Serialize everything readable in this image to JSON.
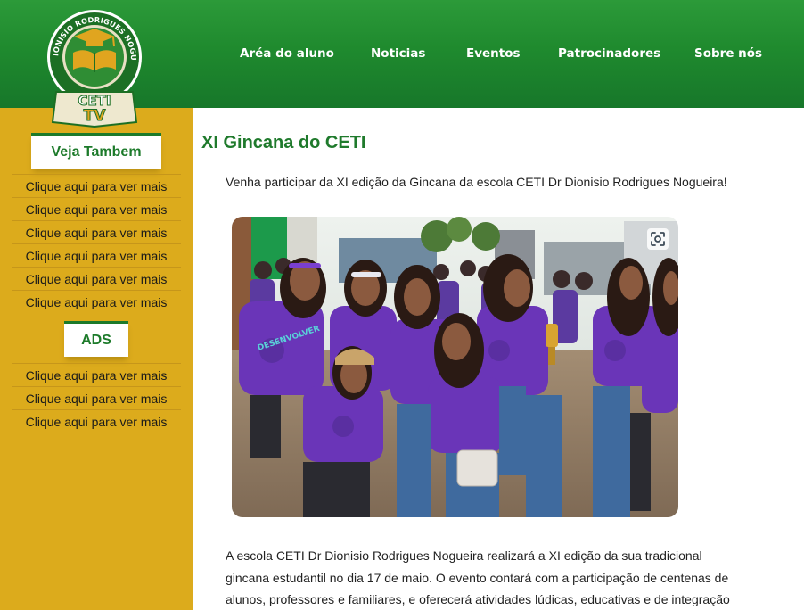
{
  "logo": {
    "ring_text": "DR. DIONISIO RODRIGUES NOGUEIRA",
    "line1": "CETI",
    "line2": "TV"
  },
  "nav": {
    "items": [
      {
        "label": "Aréa do aluno"
      },
      {
        "label": "Noticias"
      },
      {
        "label": "Eventos"
      },
      {
        "label": "Patrocinadores"
      },
      {
        "label": "Sobre nós"
      }
    ]
  },
  "sidebar": {
    "heading1": "Veja Tambem",
    "links1": [
      "Clique aqui para ver mais",
      "Clique aqui para ver mais",
      "Clique aqui para ver mais",
      "Clique aqui para ver mais",
      "Clique aqui para ver mais",
      "Clique aqui para ver mais"
    ],
    "heading2": "ADS",
    "links2": [
      "Clique aqui para ver mais",
      "Clique aqui para ver mais",
      "Clique aqui para ver mais"
    ]
  },
  "article": {
    "title": "XI Gincana do CETI",
    "intro": "Venha participar da XI edição da Gincana da escola CETI Dr Dionisio Rodrigues Nogueira!",
    "shirt_text": "DESENVOLVER",
    "body_lines": [
      "A escola CETI Dr Dionisio Rodrigues Nogueira realizará a XI edição da sua tradicional",
      "gincana estudantil no dia 17 de maio. O evento contará com a participação de centenas de",
      "alunos, professores e familiares, e oferecerá atividades lúdicas, educativas e de integração"
    ]
  },
  "colors": {
    "header_green": "#1f8a2e",
    "sidebar_gold": "#dcab1c",
    "title_green": "#1f7a2c",
    "shirt_purple": "#6a35b8"
  },
  "icons": [
    "google-lens-icon"
  ]
}
